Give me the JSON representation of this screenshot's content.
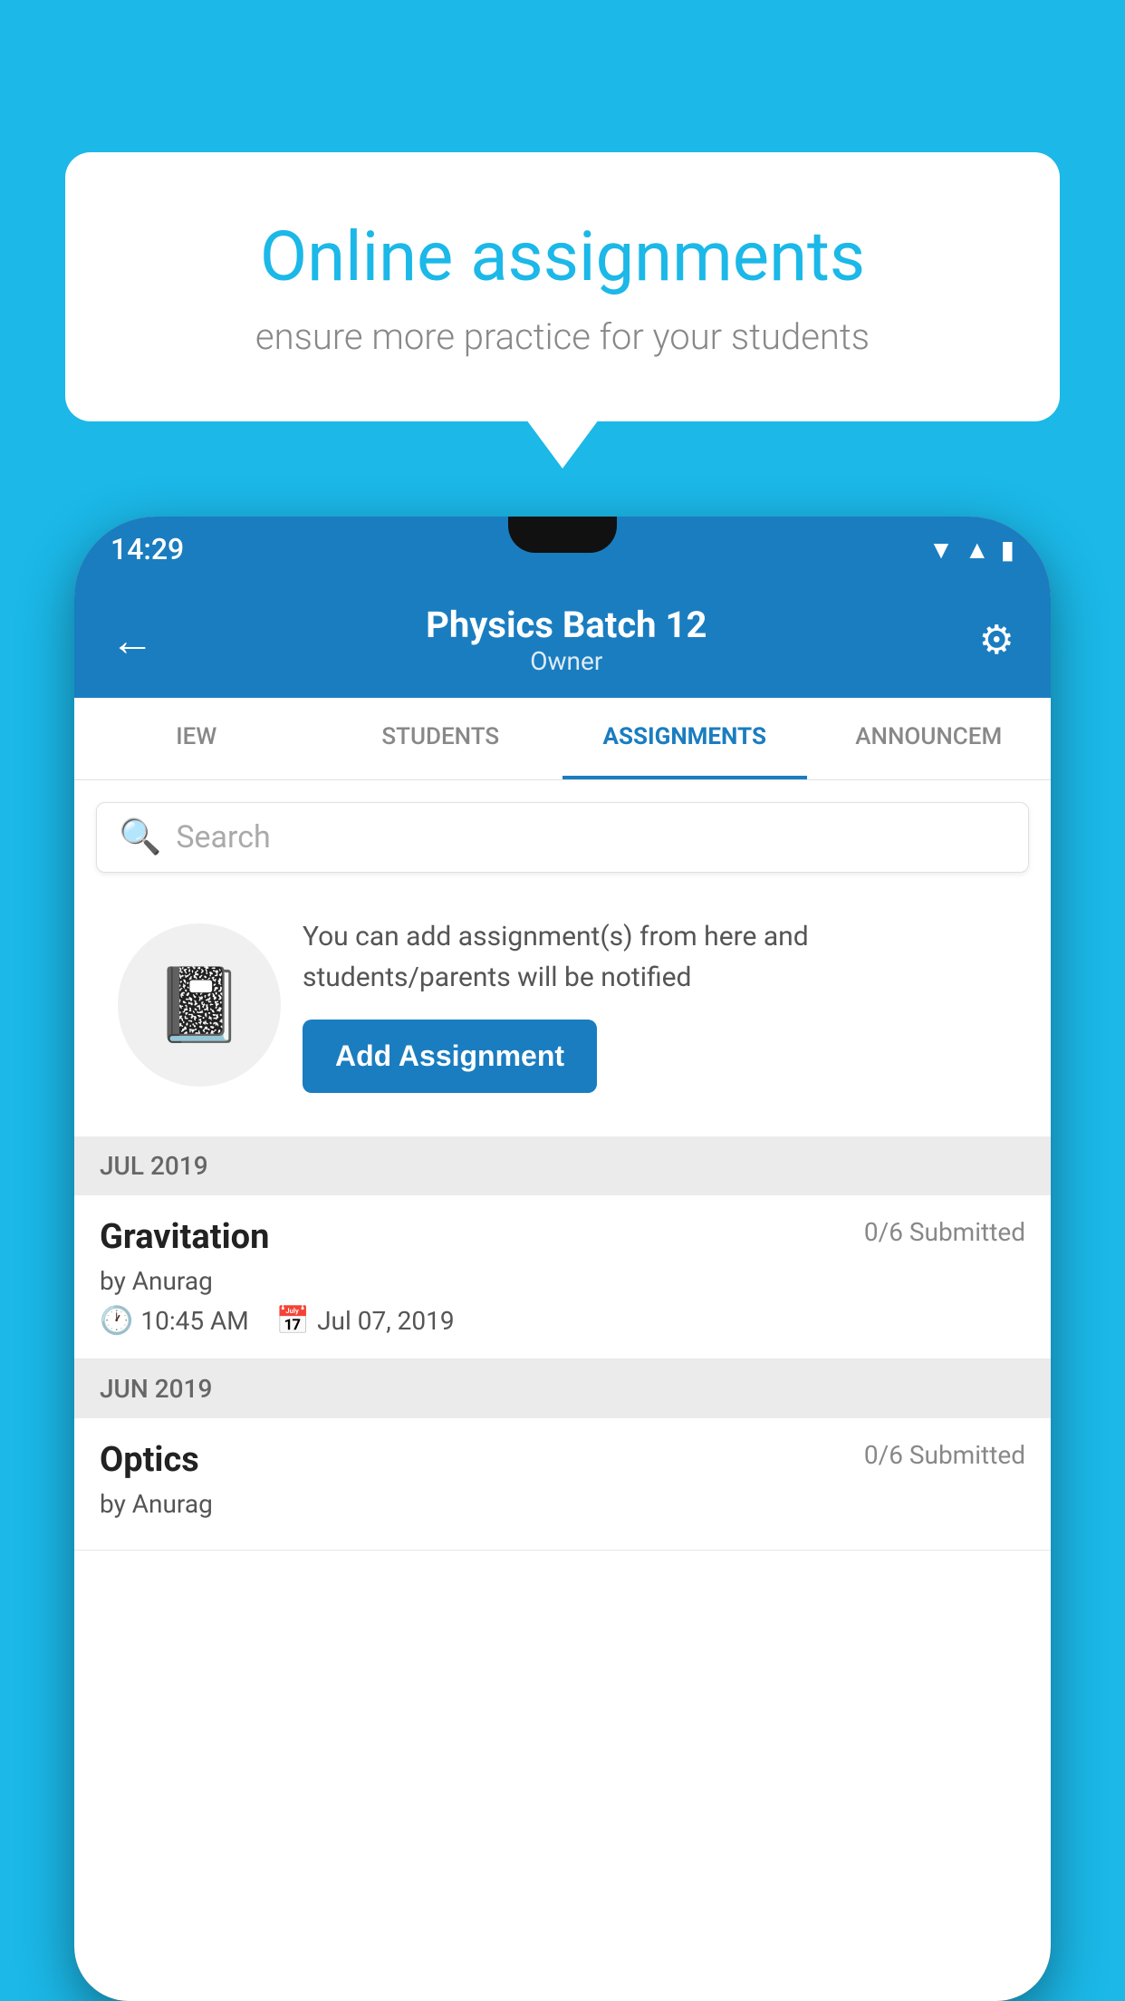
{
  "background": {
    "color": "#1BB8E8"
  },
  "speech_bubble": {
    "title": "Online assignments",
    "subtitle": "ensure more practice for your students"
  },
  "status_bar": {
    "time": "14:29",
    "wifi_icon": "▼",
    "signal_icon": "▲",
    "battery_icon": "▮"
  },
  "header": {
    "back_icon": "←",
    "title": "Physics Batch 12",
    "subtitle": "Owner",
    "gear_icon": "⚙"
  },
  "tabs": [
    {
      "label": "IEW",
      "active": false
    },
    {
      "label": "STUDENTS",
      "active": false
    },
    {
      "label": "ASSIGNMENTS",
      "active": true
    },
    {
      "label": "ANNOUNCEM...",
      "active": false
    }
  ],
  "search": {
    "placeholder": "Search",
    "search_icon": "🔍"
  },
  "info_card": {
    "icon": "📓",
    "description": "You can add assignment(s) from here and students/parents will be notified",
    "button_label": "Add Assignment"
  },
  "months": [
    {
      "label": "JUL 2019",
      "assignments": [
        {
          "name": "Gravitation",
          "submitted": "0/6 Submitted",
          "author": "by Anurag",
          "time": "10:45 AM",
          "date": "Jul 07, 2019"
        }
      ]
    },
    {
      "label": "JUN 2019",
      "assignments": [
        {
          "name": "Optics",
          "submitted": "0/6 Submitted",
          "author": "by Anurag",
          "time": "",
          "date": ""
        }
      ]
    }
  ]
}
